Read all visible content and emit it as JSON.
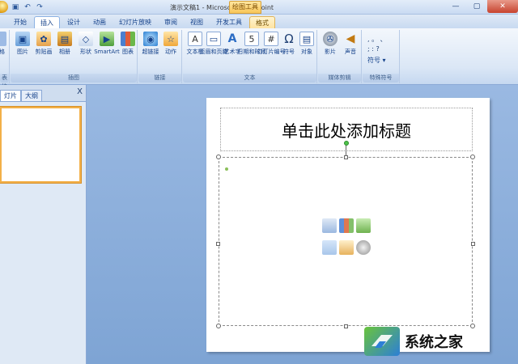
{
  "window": {
    "title": "演示文稿1 - Microsoft PowerPoint",
    "contextual_tab_group": "绘图工具",
    "controls": {
      "minimize": "—",
      "maximize": "▢",
      "close": "✕"
    }
  },
  "qat": {
    "save": "▣",
    "undo": "↶",
    "redo": "↷"
  },
  "tabs": [
    {
      "label": "开始"
    },
    {
      "label": "插入",
      "active": true
    },
    {
      "label": "设计"
    },
    {
      "label": "动画"
    },
    {
      "label": "幻灯片放映"
    },
    {
      "label": "审阅"
    },
    {
      "label": "视图"
    },
    {
      "label": "开发工具"
    },
    {
      "label": "格式",
      "context": true
    }
  ],
  "ribbon": {
    "groups": {
      "tables": {
        "label": "表格",
        "buttons": [
          {
            "label": "表格"
          }
        ]
      },
      "illustrations": {
        "label": "插图",
        "buttons": [
          {
            "label": "图片",
            "icon": "picture-icon"
          },
          {
            "label": "剪贴画",
            "icon": "clipart-icon"
          },
          {
            "label": "相册",
            "icon": "album-icon"
          },
          {
            "label": "形状",
            "icon": "shapes-icon"
          },
          {
            "label": "SmartArt",
            "icon": "smartart-icon"
          },
          {
            "label": "图表",
            "icon": "chart-icon"
          }
        ]
      },
      "links": {
        "label": "链接",
        "buttons": [
          {
            "label": "超链接",
            "icon": "hyperlink-icon"
          },
          {
            "label": "动作",
            "icon": "action-icon"
          }
        ]
      },
      "text": {
        "label": "文本",
        "buttons": [
          {
            "label": "文本框",
            "icon": "textbox-icon"
          },
          {
            "label": "页眉和页脚",
            "icon": "header-footer-icon"
          },
          {
            "label": "艺术字",
            "icon": "wordart-icon"
          },
          {
            "label": "日期和时间",
            "icon": "datetime-icon"
          },
          {
            "label": "幻灯片编号",
            "icon": "slide-number-icon"
          },
          {
            "label": "符号",
            "icon": "symbol-icon"
          },
          {
            "label": "对象",
            "icon": "object-icon"
          }
        ]
      },
      "media": {
        "label": "媒体剪辑",
        "buttons": [
          {
            "label": "影片",
            "icon": "movie-icon"
          },
          {
            "label": "声音",
            "icon": "sound-icon"
          }
        ]
      },
      "special_symbols": {
        "label": "特殊符号",
        "buttons": [
          {
            "label": "符号"
          }
        ]
      }
    }
  },
  "left_panel": {
    "tabs": [
      {
        "label": "灯片",
        "active": true
      },
      {
        "label": "大纲"
      }
    ],
    "close": "X"
  },
  "slide": {
    "title_placeholder": "单击此处添加标题"
  },
  "watermark": {
    "text": "系统之家"
  }
}
